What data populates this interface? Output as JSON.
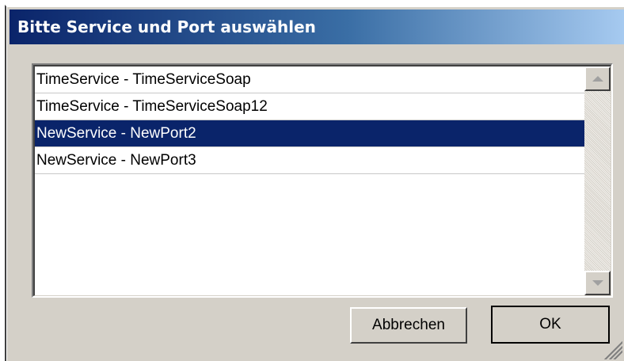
{
  "dialog": {
    "title": "Bitte Service und Port auswählen"
  },
  "list": {
    "items": [
      {
        "label": "TimeService - TimeServiceSoap",
        "selected": false
      },
      {
        "label": "TimeService - TimeServiceSoap12",
        "selected": false
      },
      {
        "label": "NewService - NewPort2",
        "selected": true
      },
      {
        "label": "NewService - NewPort3",
        "selected": false
      }
    ]
  },
  "scrollbar": {
    "up_icon": "arrow-up-icon",
    "down_icon": "arrow-down-icon"
  },
  "buttons": {
    "cancel_label": "Abbrechen",
    "ok_label": "OK"
  },
  "colors": {
    "title_start": "#0a246a",
    "title_end": "#a6caf0",
    "selection": "#0a246a",
    "face": "#d4d0c8"
  }
}
